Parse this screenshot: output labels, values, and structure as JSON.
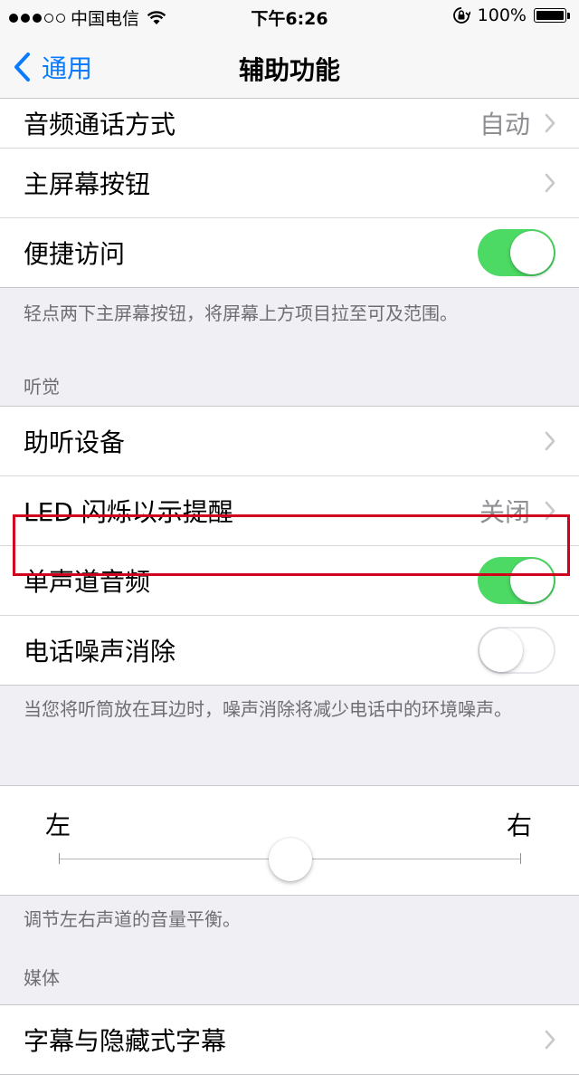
{
  "status_bar": {
    "carrier": "中国电信",
    "time": "下午6:26",
    "battery": "100%",
    "signal_bars_filled": 3,
    "signal_bars_total": 5
  },
  "nav": {
    "back_label": "通用",
    "title": "辅助功能"
  },
  "group1": {
    "rows": [
      {
        "label": "音频通话方式",
        "value": "自动"
      },
      {
        "label": "主屏幕按钮"
      },
      {
        "label": "便捷访问",
        "toggle": "on"
      }
    ],
    "footer": "轻点两下主屏幕按钮，将屏幕上方项目拉至可及范围。"
  },
  "hearing": {
    "header": "听觉",
    "rows": [
      {
        "label": "助听设备"
      },
      {
        "label": "LED 闪烁以示提醒",
        "value": "关闭"
      },
      {
        "label": "单声道音频",
        "toggle": "on"
      },
      {
        "label": "电话噪声消除",
        "toggle": "off"
      }
    ],
    "footer": "当您将听筒放在耳边时，噪声消除将减少电话中的环境噪声。"
  },
  "balance": {
    "left_label": "左",
    "right_label": "右",
    "value": 0.5,
    "footer": "调节左右声道的音量平衡。"
  },
  "media": {
    "header": "媒体",
    "rows": [
      {
        "label": "字幕与隐藏式字幕"
      }
    ]
  },
  "colors": {
    "accent": "#0a7aff",
    "toggle_on": "#4cd964",
    "highlight": "#d0021b",
    "background": "#efeff4"
  }
}
